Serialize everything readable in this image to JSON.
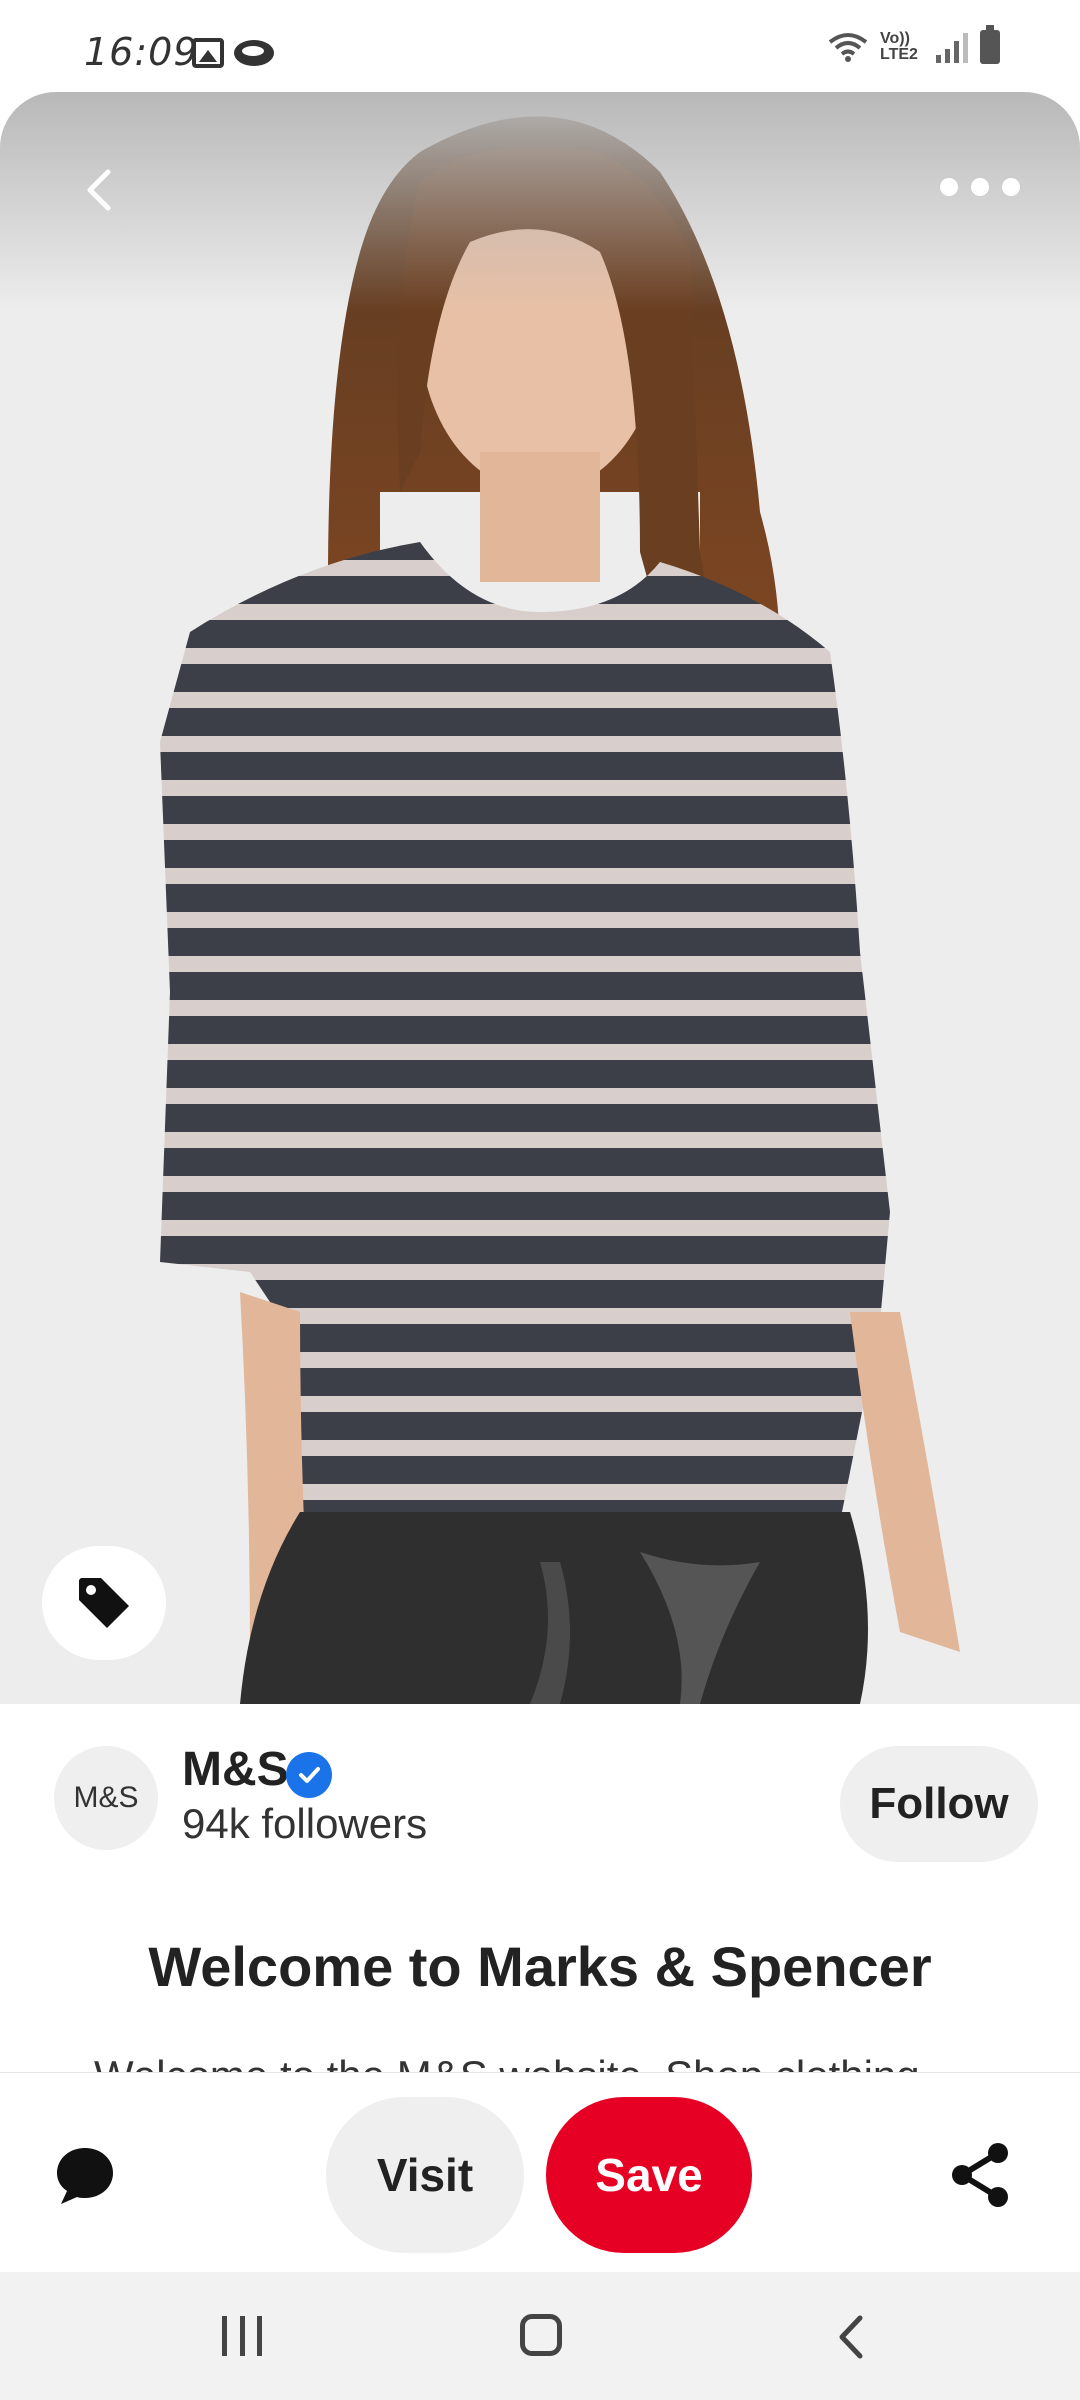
{
  "status_bar": {
    "time": "16:09",
    "network_label": "Vo)) LTE2"
  },
  "hero": {
    "back_icon": "chevron-left-icon",
    "more_icon": "more-horizontal-icon",
    "tag_icon": "tag-icon",
    "image_subject": "woman-in-striped-top-photo"
  },
  "creator": {
    "avatar_text": "M&S",
    "name": "M&S",
    "verified_icon": "verified-check-icon",
    "followers": "94k followers",
    "follow_label": "Follow"
  },
  "pin": {
    "title": "Welcome to Marks & Spencer",
    "description": "Welcome to the M&S website. Shop clothing"
  },
  "actions": {
    "comment_icon": "comment-icon",
    "visit_label": "Visit",
    "save_label": "Save",
    "share_icon": "share-icon"
  },
  "colors": {
    "save_red": "#e60023",
    "verified_blue": "#1a73e8",
    "button_grey": "#efefef"
  }
}
